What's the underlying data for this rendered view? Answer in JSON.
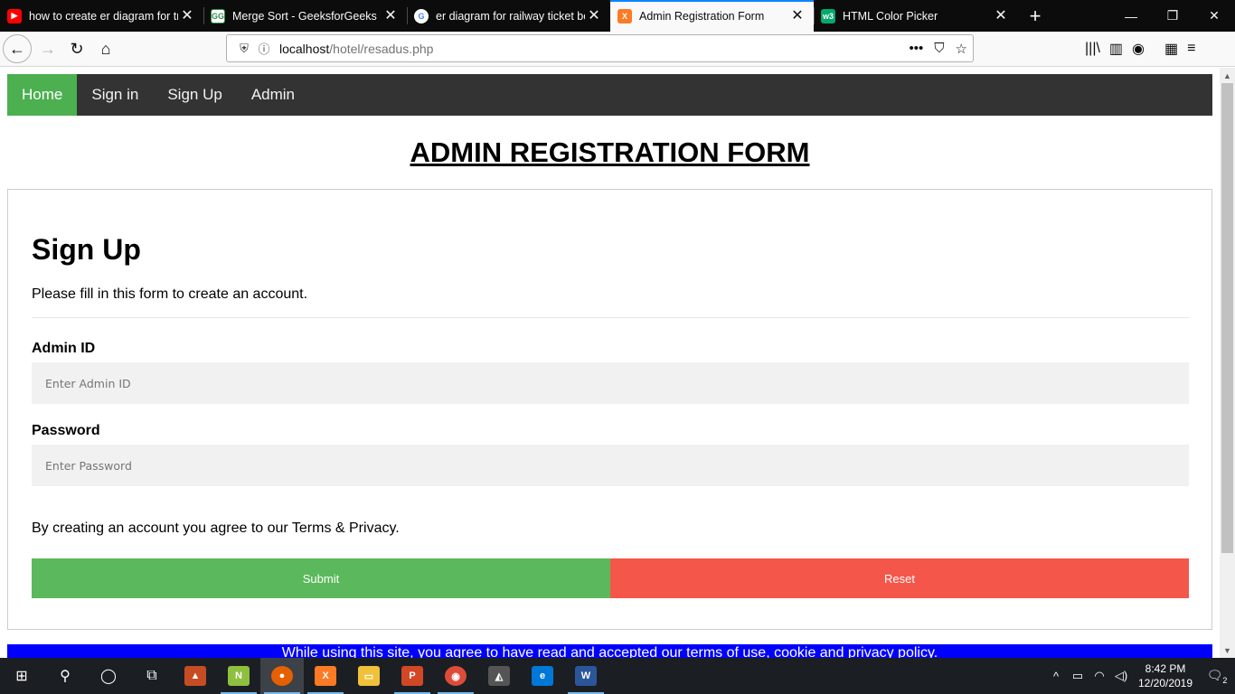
{
  "tabs": [
    {
      "title": "how to create er diagram for tr",
      "icon": "youtube-icon",
      "favicon": "▶",
      "active": false
    },
    {
      "title": "Merge Sort - GeeksforGeeks",
      "icon": "geeksforgeeks-icon",
      "favicon": "GG",
      "active": false
    },
    {
      "title": "er diagram for railway ticket bo",
      "icon": "google-icon",
      "favicon": "G",
      "active": false
    },
    {
      "title": "Admin Registration Form",
      "icon": "xampp-icon",
      "favicon": "X",
      "active": true
    },
    {
      "title": "HTML Color Picker",
      "icon": "w3schools-icon",
      "favicon": "w3",
      "active": false
    }
  ],
  "tab_close_glyph": "✕",
  "newtab_glyph": "+",
  "window_controls": {
    "minimize": "—",
    "restore": "❐",
    "close": "✕"
  },
  "navbar": {
    "back": "←",
    "forward": "→",
    "reload": "↻",
    "home": "⌂",
    "url_host": "localhost",
    "url_path": "/hotel/resadus.php",
    "url_more": "•••",
    "pocket": "⛉",
    "bookmark_star": "☆",
    "library": "|||\\",
    "sidebar": "▥",
    "account": "◉",
    "extensions": "▦",
    "menu": "≡"
  },
  "site_nav": {
    "items": [
      {
        "label": "Home",
        "active": true
      },
      {
        "label": "Sign in",
        "active": false
      },
      {
        "label": "Sign Up",
        "active": false
      },
      {
        "label": "Admin",
        "active": false
      }
    ]
  },
  "page": {
    "heading": "ADMIN REGISTRATION FORM",
    "form_title": "Sign Up",
    "form_subtitle": "Please fill in this form to create an account.",
    "admin_id_label": "Admin ID",
    "admin_id_placeholder": "Enter Admin ID",
    "admin_id_value": "",
    "password_label": "Password",
    "password_placeholder": "Enter Password",
    "password_value": "",
    "terms_text": "By creating an account you agree to our Terms & Privacy.",
    "submit_label": "Submit",
    "reset_label": "Reset",
    "cookie_notice": "While using this site, you agree to have read and accepted our terms of use, cookie and privacy policy."
  },
  "colors": {
    "nav_bg": "#333333",
    "nav_active": "#4caf50",
    "submit": "#5cb85c",
    "reset": "#f4574a",
    "cookie_bar": "#0000ff",
    "input_bg": "#f1f1f1"
  },
  "scrollbar": {
    "up": "▲",
    "down": "▼"
  },
  "taskbar": {
    "apps": [
      {
        "name": "start-button",
        "glyph": "⊞"
      },
      {
        "name": "search-icon",
        "glyph": "⚲"
      },
      {
        "name": "cortana-icon",
        "glyph": "◯"
      },
      {
        "name": "task-view-icon",
        "glyph": "⧉"
      },
      {
        "name": "matlab-icon",
        "glyph": "▲"
      },
      {
        "name": "notepad-plus-icon",
        "glyph": "N"
      },
      {
        "name": "firefox-icon",
        "glyph": "●"
      },
      {
        "name": "xampp-icon",
        "glyph": "X"
      },
      {
        "name": "file-explorer-icon",
        "glyph": "▭"
      },
      {
        "name": "powerpoint-icon",
        "glyph": "P"
      },
      {
        "name": "chrome-icon",
        "glyph": "◉"
      },
      {
        "name": "photos-icon",
        "glyph": "◭"
      },
      {
        "name": "edge-icon",
        "glyph": "e"
      },
      {
        "name": "word-icon",
        "glyph": "W"
      }
    ],
    "tray": {
      "chevron": "^",
      "battery": "▭",
      "wifi": "◠",
      "volume": "◁)",
      "time": "8:42 PM",
      "date": "12/20/2019",
      "notifications": "🗨",
      "notification_count": "2"
    }
  }
}
